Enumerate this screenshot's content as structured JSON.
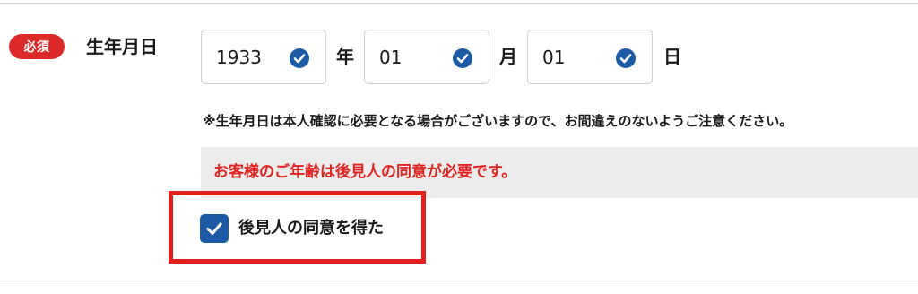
{
  "field": {
    "required_badge": "必須",
    "label": "生年月日"
  },
  "birthdate": {
    "year": {
      "value": "1933",
      "unit": "年",
      "icon": "check-circle-icon"
    },
    "month": {
      "value": "01",
      "unit": "月",
      "icon": "check-circle-icon"
    },
    "day": {
      "value": "01",
      "unit": "日",
      "icon": "check-circle-icon"
    }
  },
  "note": "※生年月日は本人確認に必要となる場合がございますので、お間違えのないようご注意ください。",
  "warning": "お客様のご年齢は後見人の同意が必要です。",
  "guardian_consent": {
    "label": "後見人の同意を得た",
    "checked": true
  },
  "colors": {
    "required": "#dc2a2a",
    "check_blue": "#1c5aa6",
    "warning_text": "#e0231f",
    "warning_bg": "#ececec",
    "highlight_frame": "#e1201e"
  }
}
